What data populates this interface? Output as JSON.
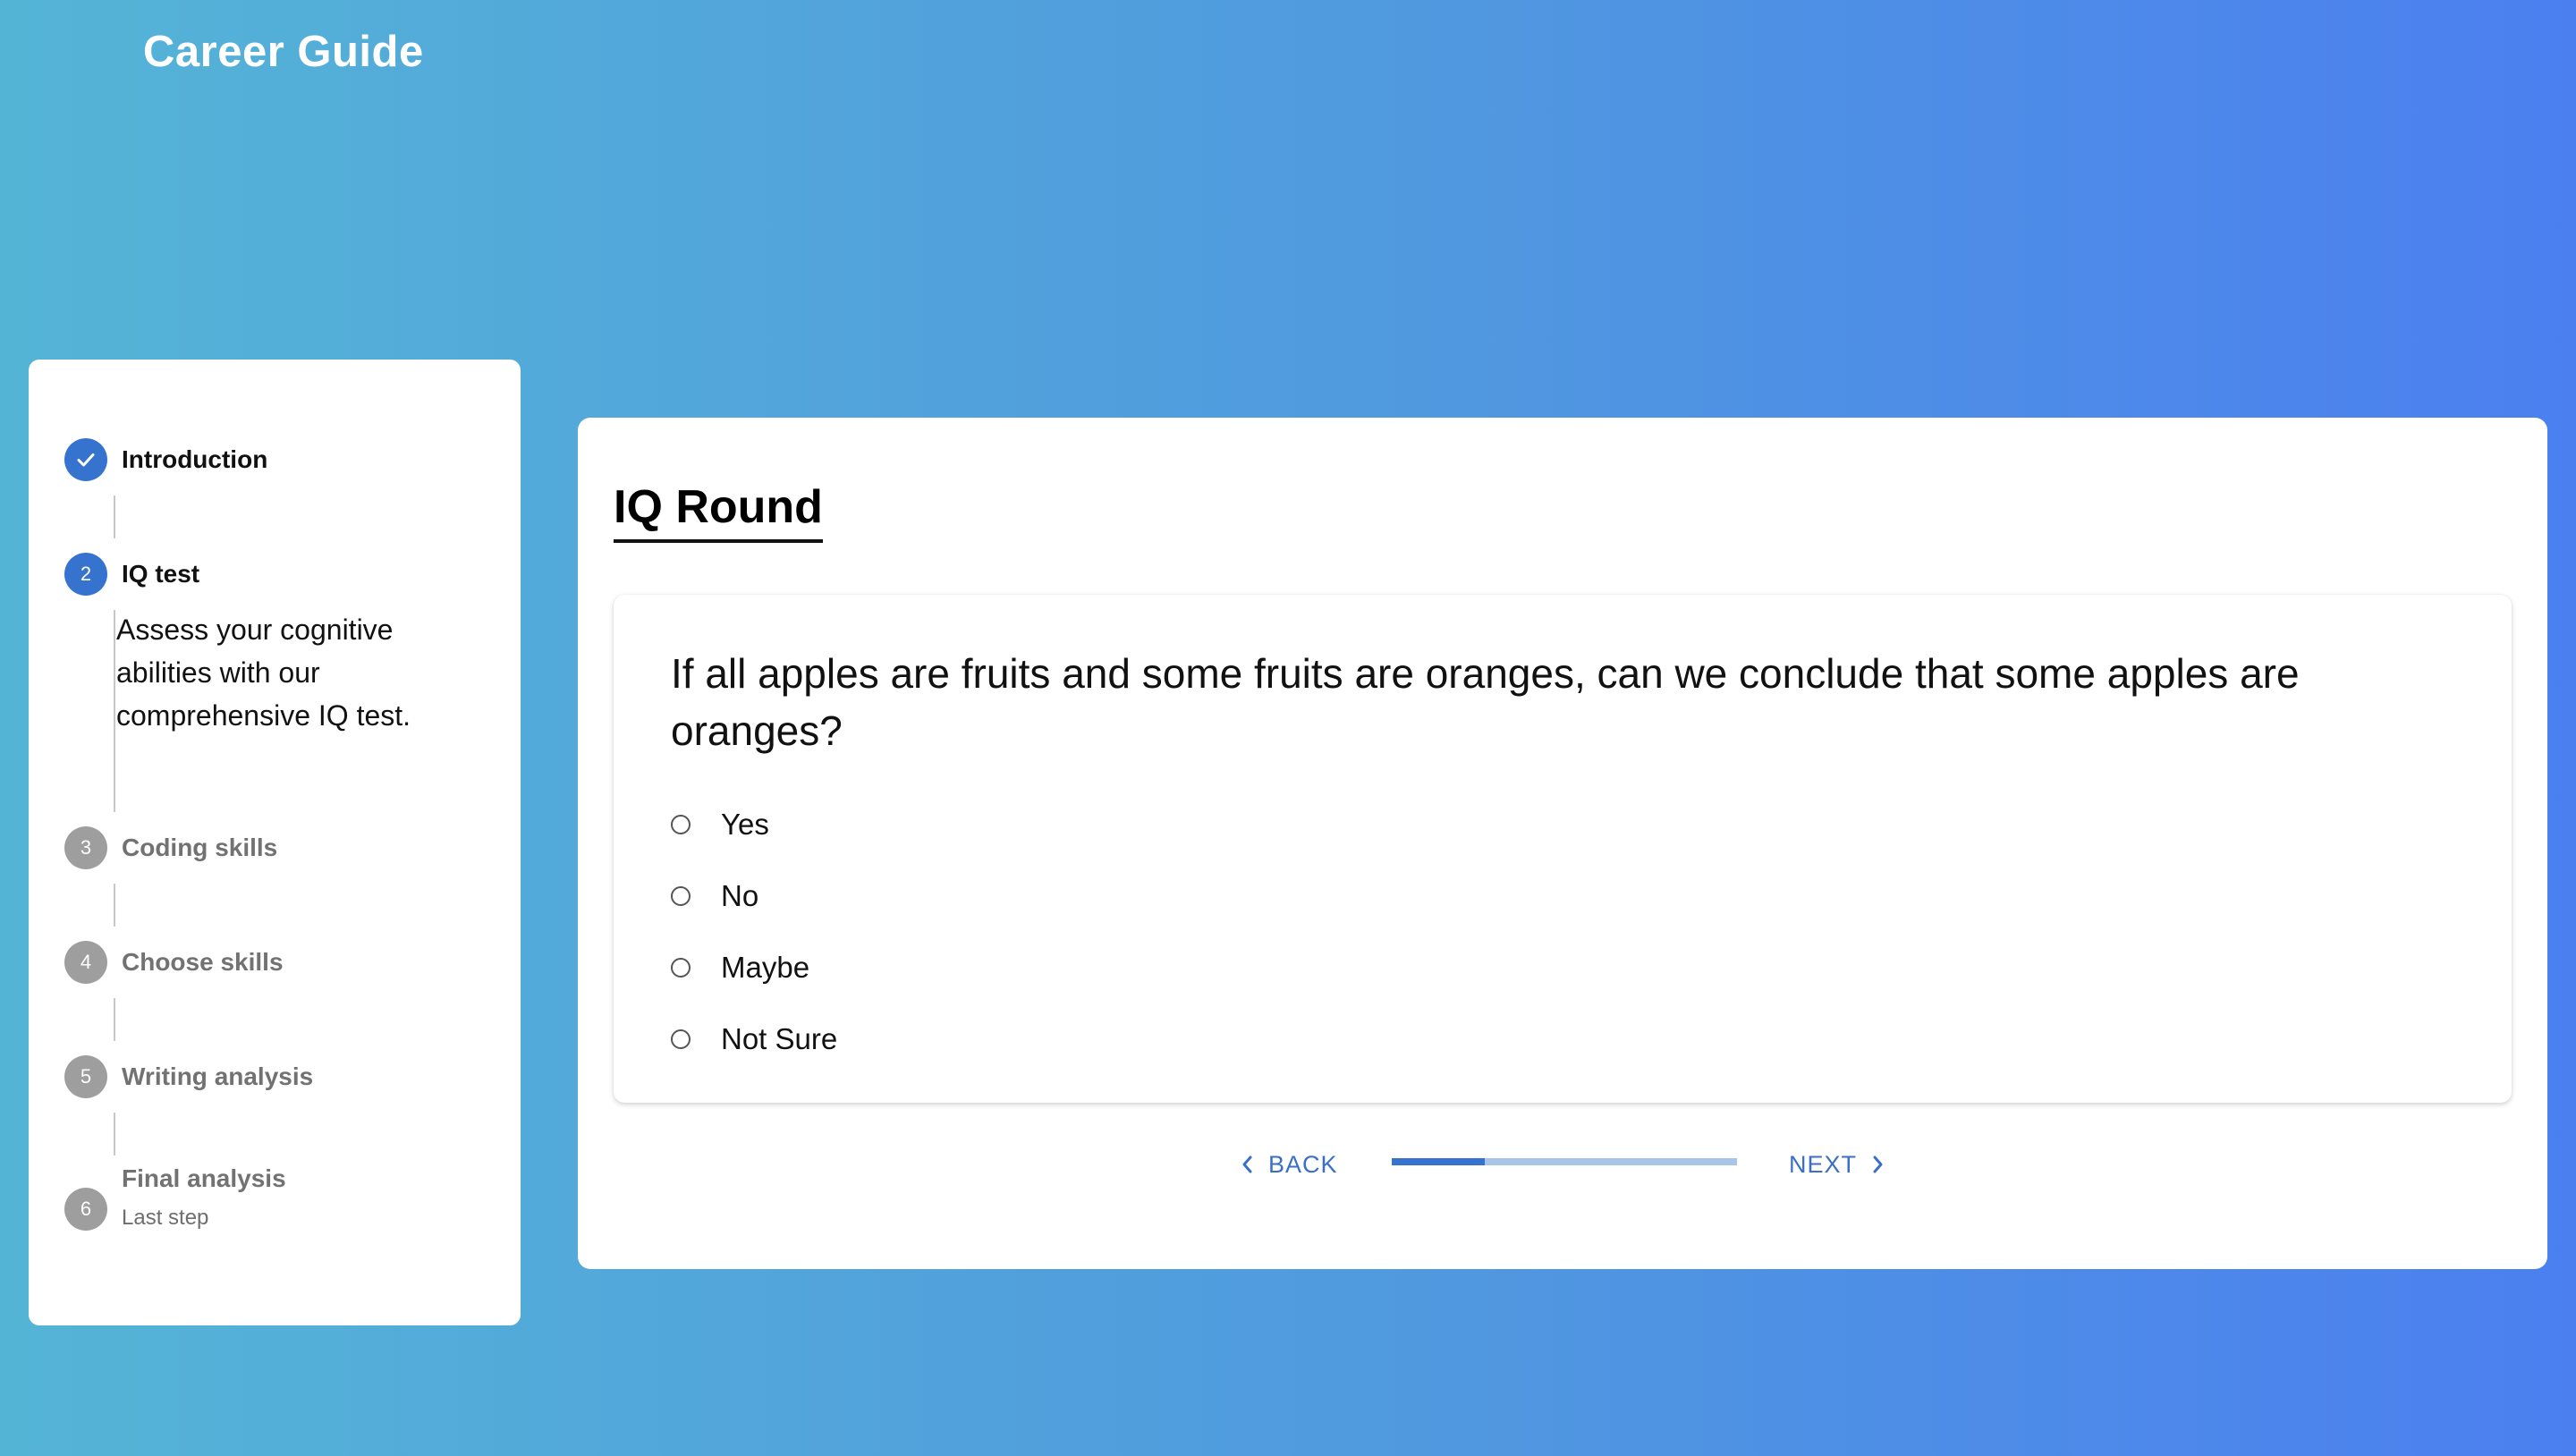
{
  "app": {
    "title": "Career Guide"
  },
  "stepper": {
    "steps": [
      {
        "number": "1",
        "label": "Introduction",
        "status": "done"
      },
      {
        "number": "2",
        "label": "IQ test",
        "status": "current",
        "description": "Assess your cognitive abilities with our comprehensive IQ test."
      },
      {
        "number": "3",
        "label": "Coding skills",
        "status": "pending"
      },
      {
        "number": "4",
        "label": "Choose skills",
        "status": "pending"
      },
      {
        "number": "5",
        "label": "Writing analysis",
        "status": "pending"
      },
      {
        "number": "6",
        "label": "Final analysis",
        "status": "pending",
        "sublabel": "Last step"
      }
    ]
  },
  "main": {
    "round_title": "IQ Round",
    "question": "If all apples are fruits and some fruits are oranges, can we conclude that some apples are oranges?",
    "options": [
      "Yes",
      "No",
      "Maybe",
      "Not Sure"
    ],
    "selected_option": null
  },
  "navigation": {
    "back_label": "BACK",
    "next_label": "NEXT",
    "progress_fraction": 0.27
  },
  "colors": {
    "accent": "#3673cf",
    "progress_track": "#a8c5ea",
    "inactive_step": "#9e9e9e"
  }
}
